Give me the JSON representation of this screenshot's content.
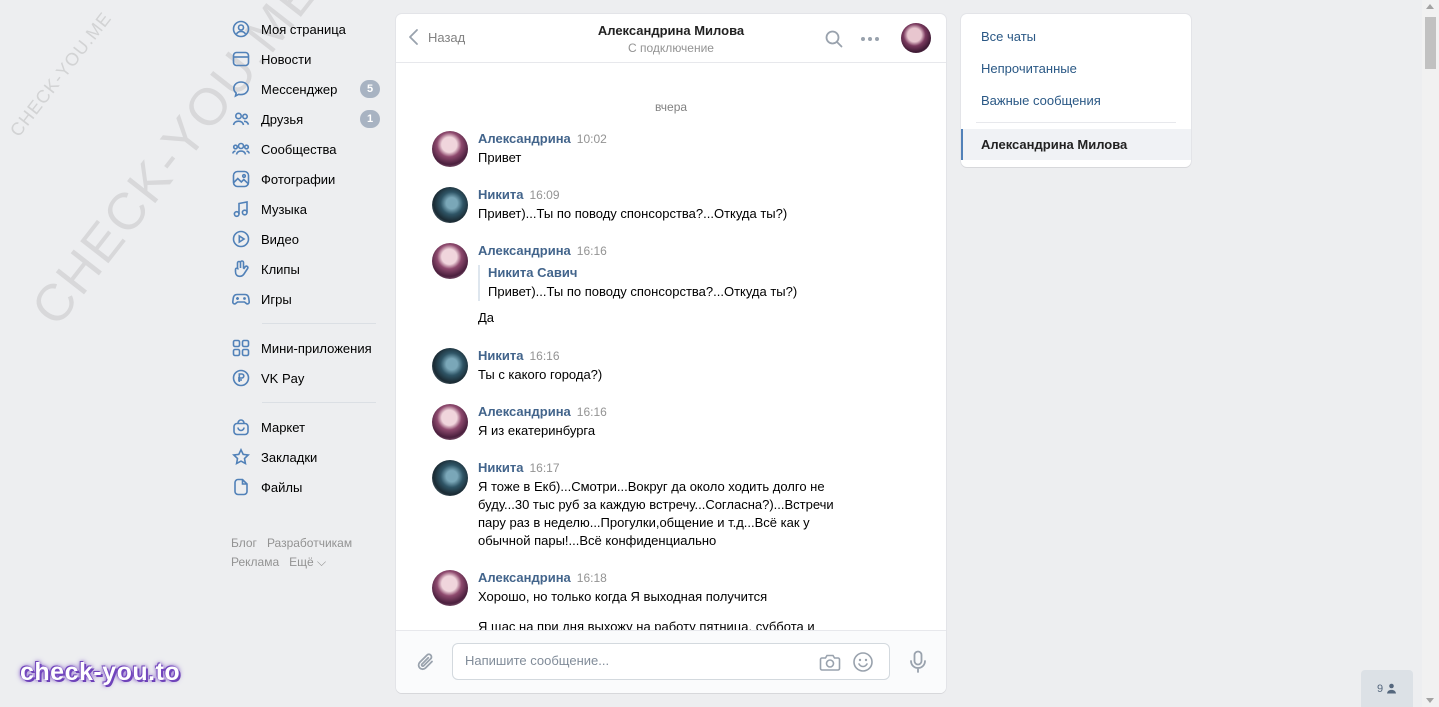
{
  "nav": {
    "items": [
      {
        "label": "Моя страница",
        "icon": "user-circle-icon"
      },
      {
        "label": "Новости",
        "icon": "news-icon"
      },
      {
        "label": "Мессенджер",
        "icon": "message-icon",
        "badge": "5"
      },
      {
        "label": "Друзья",
        "icon": "friends-icon",
        "badge": "1"
      },
      {
        "label": "Сообщества",
        "icon": "communities-icon"
      },
      {
        "label": "Фотографии",
        "icon": "photo-icon"
      },
      {
        "label": "Музыка",
        "icon": "music-icon"
      },
      {
        "label": "Видео",
        "icon": "video-icon"
      },
      {
        "label": "Клипы",
        "icon": "clips-icon"
      },
      {
        "label": "Игры",
        "icon": "gamepad-icon"
      },
      {
        "label": "Мини-приложения",
        "icon": "apps-icon"
      },
      {
        "label": "VK Pay",
        "icon": "vkpay-icon"
      },
      {
        "label": "Маркет",
        "icon": "market-icon"
      },
      {
        "label": "Закладки",
        "icon": "star-icon"
      },
      {
        "label": "Файлы",
        "icon": "file-icon"
      }
    ],
    "footer": {
      "blog": "Блог",
      "developers": "Разработчикам",
      "ads": "Реклама",
      "more": "Ещё ⌵"
    }
  },
  "chat": {
    "back_label": "Назад",
    "title": "Александрина Милова",
    "status": "С подключение",
    "day_separator": "вчера",
    "messages": [
      {
        "author": "Александрина",
        "time": "10:02",
        "text": "Привет",
        "who": "alex"
      },
      {
        "author": "Никита",
        "time": "16:09",
        "text": "Привет)...Ты по поводу спонсорства?...Откуда ты?)",
        "who": "nik"
      },
      {
        "author": "Александрина",
        "time": "16:16",
        "fwd_author": "Никита Савич",
        "fwd_text": "Привет)...Ты по поводу спонсорства?...Откуда ты?)",
        "text": "Да",
        "who": "alex"
      },
      {
        "author": "Никита",
        "time": "16:16",
        "text": "Ты с какого города?)",
        "who": "nik"
      },
      {
        "author": "Александрина",
        "time": "16:16",
        "text": "Я из екатеринбурга",
        "who": "alex"
      },
      {
        "author": "Никита",
        "time": "16:17",
        "text": "Я тоже в Екб)...Смотри...Вокруг да около ходить долго не буду...30 тыс руб за каждую встречу...Согласна?)...Встречи пару раз в неделю...Прогулки,общение и т.д...Всё как у обычной пары!...Всё конфиденциально",
        "who": "nik"
      },
      {
        "author": "Александрина",
        "time": "16:18",
        "text": "Хорошо, но только когда Я выходная получится",
        "extra": "Я щас на при дня выхожу на работу пятница, суббота и",
        "who": "alex"
      }
    ],
    "composer_placeholder": "Напишите сообщение..."
  },
  "right_panel": {
    "all_chats": "Все чаты",
    "unread": "Непрочитанные",
    "important": "Важные сообщения",
    "active_chat": "Александрина Милова"
  },
  "watermark": {
    "small": "CHECK-YOU.ME",
    "big": "CHECK-YOU.ME",
    "brand": "check-you.to"
  },
  "online_count": "9",
  "colors": {
    "accent": "#5181b8",
    "author": "#42648b",
    "background": "#edeef0"
  }
}
